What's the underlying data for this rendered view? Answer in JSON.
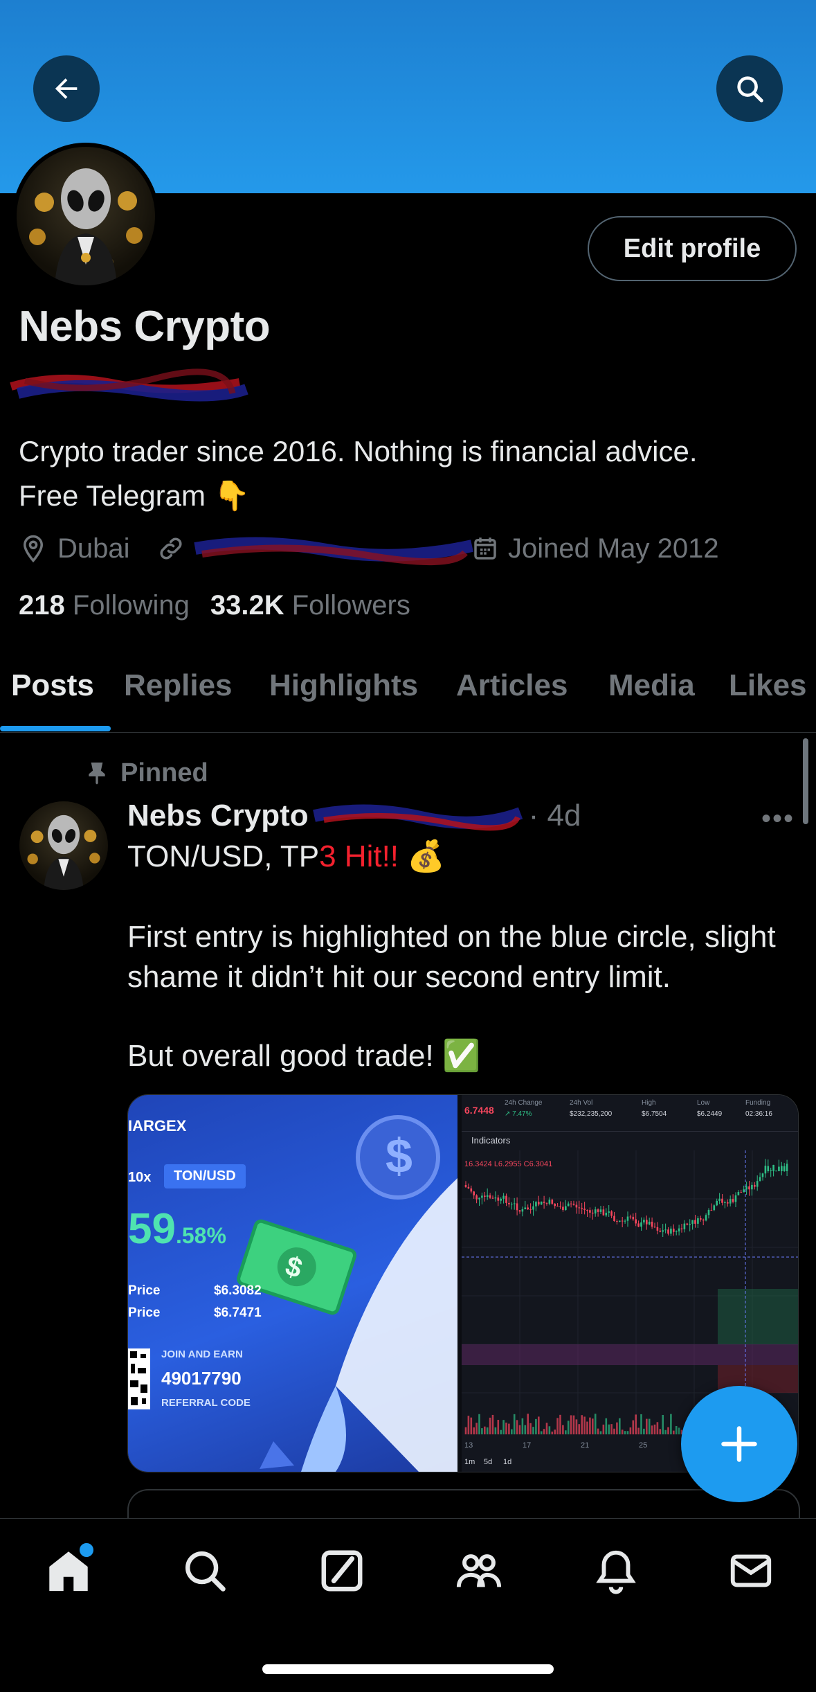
{
  "profile": {
    "name": "Nebs Crypto",
    "bio_line1": "Crypto trader since 2016. Nothing is financial advice.",
    "bio_line2": "Free Telegram 👇",
    "location": "Dubai",
    "joined": "Joined May 2012",
    "following_count": "218",
    "following_label": "Following",
    "followers_count": "33.2K",
    "followers_label": "Followers",
    "edit_label": "Edit profile"
  },
  "tabs": [
    {
      "label": "Posts",
      "active": true
    },
    {
      "label": "Replies"
    },
    {
      "label": "Highlights"
    },
    {
      "label": "Articles"
    },
    {
      "label": "Media"
    },
    {
      "label": "Likes"
    }
  ],
  "post": {
    "pinned_label": "Pinned",
    "author": "Nebs Crypto",
    "time": "· 4d",
    "line1_prefix": "TON/USD, TP",
    "line1_red": "3 Hit!!",
    "line1_emoji": "💰",
    "para2": "First entry is highlighted on the blue circle, slight shame it didn’t hit our second entry limit.",
    "para3": "But overall good trade! ✅",
    "more": "•••"
  },
  "promo": {
    "brand": "IARGEX",
    "leverage": "10x",
    "pair": "TON/USD",
    "pnl_big": "59",
    "pnl_small": ".58%",
    "entry_label": "Price",
    "entry_value": "$6.3082",
    "exit_label": "Price",
    "exit_value": "$6.7471",
    "join": "JOIN AND EARN",
    "code": "49017790",
    "ref": "REFERRAL CODE"
  },
  "chart": {
    "price": "6.7448",
    "stat_labels": [
      "24h Change",
      "24h Vol",
      "High",
      "Low",
      "Funding"
    ],
    "stat_values": [
      "↗ 7.47%",
      "$232,235,200",
      "$6.7504",
      "$6.2449",
      "02:36:16"
    ],
    "indicators": "Indicators",
    "ohlc": "16.3424 L6.2955 C6.3041",
    "x_ticks": [
      "13",
      "17",
      "21",
      "25"
    ],
    "timeframes": [
      "1m",
      "5d",
      "1d"
    ],
    "colors": {
      "up": "#2ebd85",
      "down": "#f6465d"
    }
  },
  "icons": {
    "back": "back-arrow-icon",
    "search": "search-icon",
    "location": "location-pin-icon",
    "link": "link-icon",
    "calendar": "calendar-icon",
    "pin": "pin-icon",
    "compose": "plus-icon",
    "nav": [
      "home-icon",
      "explore-icon",
      "grok-icon",
      "communities-icon",
      "notifications-icon",
      "messages-icon"
    ]
  },
  "colors": {
    "accent": "#1d9bf0",
    "banner": "#2499ea",
    "red_text": "#f4212e"
  }
}
